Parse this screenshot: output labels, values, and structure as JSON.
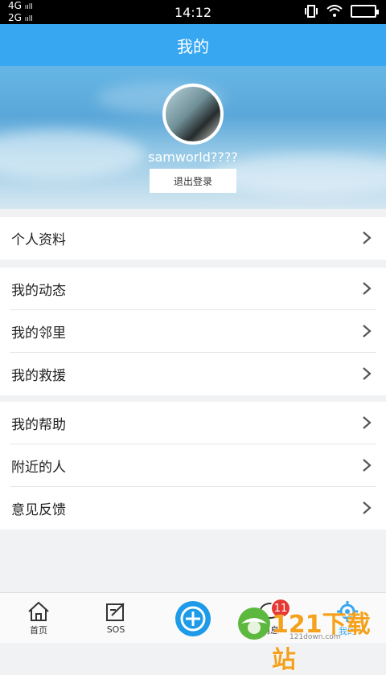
{
  "status": {
    "net": "4G\n2G",
    "time": "14:12"
  },
  "header": {
    "title": "我的"
  },
  "profile": {
    "username": "samworld????",
    "logout_label": "退出登录"
  },
  "groups": [
    [
      {
        "label": "个人资料"
      }
    ],
    [
      {
        "label": "我的动态"
      },
      {
        "label": "我的邻里"
      },
      {
        "label": "我的救援"
      }
    ],
    [
      {
        "label": "我的帮助"
      },
      {
        "label": "附近的人"
      },
      {
        "label": "意见反馈"
      }
    ]
  ],
  "tabs": [
    {
      "label": "首页",
      "icon": "home-icon"
    },
    {
      "label": "SOS",
      "icon": "edit-icon"
    },
    {
      "label": "",
      "icon": "plus-icon"
    },
    {
      "label": "消息",
      "icon": "message-icon"
    },
    {
      "label": "我的",
      "icon": "gear-icon"
    }
  ],
  "badge": {
    "count": "11"
  },
  "watermark": {
    "text": "121下载站",
    "sub": "121down.com"
  },
  "colors": {
    "accent": "#38a7f2",
    "badge": "#e53935"
  }
}
